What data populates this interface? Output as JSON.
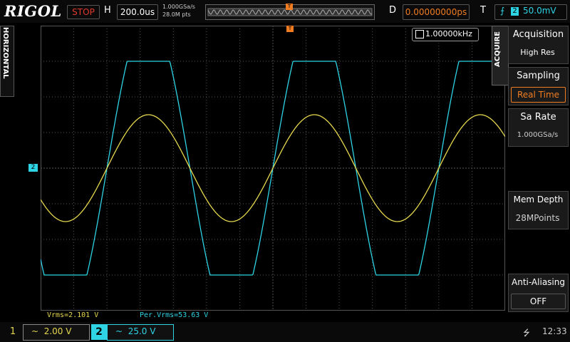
{
  "brand": "RIGOL",
  "topbar": {
    "run_status": "STOP",
    "h_label": "H",
    "timebase": "200.0us",
    "sample_rate": "1.000GSa/s",
    "mem_points": "28.0M pts",
    "d_label": "D",
    "delay": "0.00000000ps",
    "t_label": "T",
    "trigger_channel": "2",
    "trigger_level": "50.0mV",
    "trigger_slope_icon": "rising-edge-icon"
  },
  "left_tab": {
    "label": "HORIZONTAL"
  },
  "freq_counter": {
    "value": "1.00000kHz"
  },
  "channel2_marker": "2",
  "measurements": {
    "m1": "Vrms=2.101 V",
    "m2": "Per.Vrms=53.63 V"
  },
  "menu": {
    "tab_label": "ACQUIRE",
    "items": [
      {
        "title": "Acquisition",
        "value": "High Res"
      },
      {
        "title": "Sampling",
        "value": "Real Time"
      },
      {
        "title": "Sa Rate",
        "value": "1.000GSa/s"
      },
      {
        "title": "Mem Depth",
        "value": "28MPoints"
      },
      {
        "title": "Anti-Aliasing",
        "value": "OFF"
      }
    ]
  },
  "bottombar": {
    "ch1_label": "1",
    "ch1_scale": "2.00 V",
    "ch2_label": "2",
    "ch2_scale": "25.0 V",
    "coupling_icon": "ac-coupling-icon",
    "usb_icon": "usb-icon",
    "time": "12:33"
  },
  "colors": {
    "ch1": "#e6d84e",
    "ch2": "#2ed3e4",
    "trigger": "#f07d22",
    "grid": "#555555"
  },
  "waveforms": {
    "frequency_hz": 1000,
    "ch1_amplitude_div": 1.5,
    "ch2_amplitude_div": 3.0,
    "ch2_clip_div": 3.0
  }
}
